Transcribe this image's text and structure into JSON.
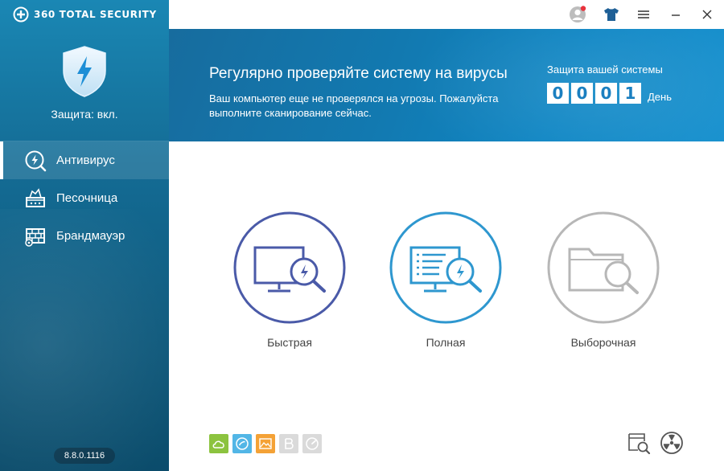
{
  "app": {
    "brand": "360 TOTAL SECURITY",
    "version": "8.8.0.1116",
    "accent": "#1a87b4"
  },
  "sidebar": {
    "status": "Защита: вкл.",
    "items": [
      {
        "label": "Антивирус",
        "icon": "antivirus-icon",
        "active": true
      },
      {
        "label": "Песочница",
        "icon": "sandbox-icon",
        "active": false
      },
      {
        "label": "Брандмауэр",
        "icon": "firewall-icon",
        "active": false
      }
    ]
  },
  "titlebar": {
    "icons": [
      "user-avatar-icon",
      "skin-shirt-icon",
      "menu-icon",
      "minimize-icon",
      "close-icon"
    ]
  },
  "banner": {
    "title": "Регулярно проверяйте систему на вирусы",
    "subtitle": "Ваш компьютер еще не проверялся на угрозы. Пожалуйста выполните сканирование сейчас.",
    "protection_label": "Защита вашей системы",
    "days_digits": [
      "0",
      "0",
      "0",
      "1"
    ],
    "days_unit": "День"
  },
  "scans": [
    {
      "label": "Быстрая",
      "icon": "quick-scan-icon",
      "color": "#4a5aa8"
    },
    {
      "label": "Полная",
      "icon": "full-scan-icon",
      "color": "#2e97cf"
    },
    {
      "label": "Выборочная",
      "icon": "custom-scan-icon",
      "color": "#b7b7b7"
    }
  ],
  "tools": [
    {
      "icon": "cloud-icon",
      "color": "#8cc33f"
    },
    {
      "icon": "speedometer-icon",
      "color": "#52b6e6"
    },
    {
      "icon": "image-icon",
      "color": "#f4a236"
    },
    {
      "icon": "letter-b-icon",
      "color": "#dadada"
    },
    {
      "icon": "gauge-icon",
      "color": "#dadada"
    }
  ],
  "bottom_right": [
    "quarantine-search-icon",
    "radiation-icon"
  ]
}
